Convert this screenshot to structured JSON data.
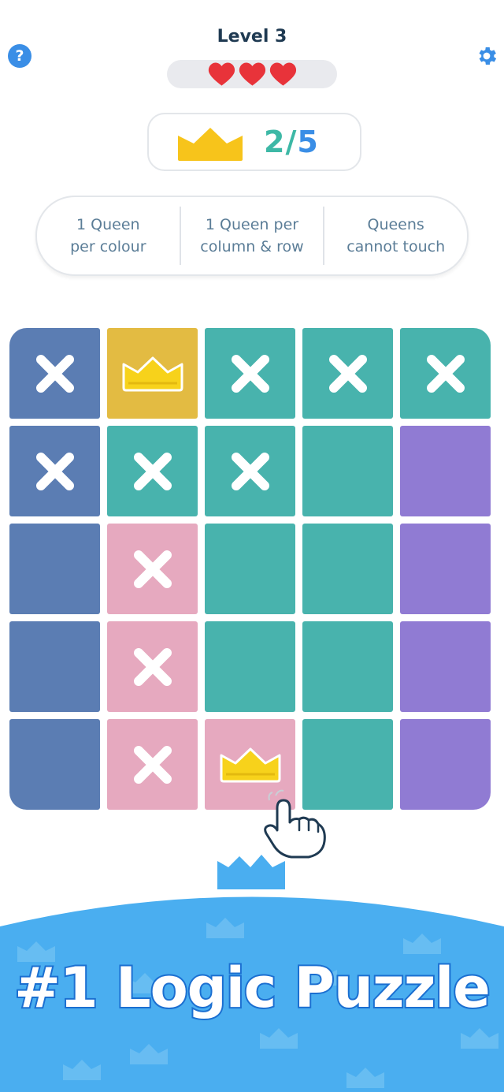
{
  "header": {
    "title": "Level 3",
    "help_label": "?",
    "lives": 3,
    "help_icon": "question-icon",
    "settings_icon": "gear-icon"
  },
  "progress": {
    "current": "2",
    "separator": "/",
    "total": "5",
    "icon": "crown-icon"
  },
  "rules": [
    {
      "line1": "1 Queen",
      "line2": "per colour"
    },
    {
      "line1": "1 Queen per",
      "line2": "column & row"
    },
    {
      "line1": "Queens",
      "line2": "cannot touch"
    }
  ],
  "colors": {
    "navy": "#5b7db3",
    "gold": "#e3bb42",
    "teal": "#48b3ad",
    "purple": "#907bd3",
    "pink": "#e6a9bf",
    "accent": "#3a8ee6",
    "banner": "#4aaef0"
  },
  "board": {
    "rows": 5,
    "cols": 5,
    "cells": [
      [
        {
          "c": "navy",
          "m": "x"
        },
        {
          "c": "gold",
          "m": "queen"
        },
        {
          "c": "teal",
          "m": "x"
        },
        {
          "c": "teal",
          "m": "x"
        },
        {
          "c": "teal",
          "m": "x"
        }
      ],
      [
        {
          "c": "navy",
          "m": "x"
        },
        {
          "c": "teal",
          "m": "x"
        },
        {
          "c": "teal",
          "m": "x"
        },
        {
          "c": "teal",
          "m": ""
        },
        {
          "c": "purple",
          "m": ""
        }
      ],
      [
        {
          "c": "navy",
          "m": ""
        },
        {
          "c": "pink",
          "m": "x"
        },
        {
          "c": "teal",
          "m": ""
        },
        {
          "c": "teal",
          "m": ""
        },
        {
          "c": "purple",
          "m": ""
        }
      ],
      [
        {
          "c": "navy",
          "m": ""
        },
        {
          "c": "pink",
          "m": "x"
        },
        {
          "c": "teal",
          "m": ""
        },
        {
          "c": "teal",
          "m": ""
        },
        {
          "c": "purple",
          "m": ""
        }
      ],
      [
        {
          "c": "navy",
          "m": ""
        },
        {
          "c": "pink",
          "m": "x"
        },
        {
          "c": "pink",
          "m": "queen"
        },
        {
          "c": "teal",
          "m": ""
        },
        {
          "c": "purple",
          "m": ""
        }
      ]
    ]
  },
  "promo": {
    "tagline": "#1 Logic Puzzle",
    "pointer_icon": "pointing-hand-icon"
  }
}
